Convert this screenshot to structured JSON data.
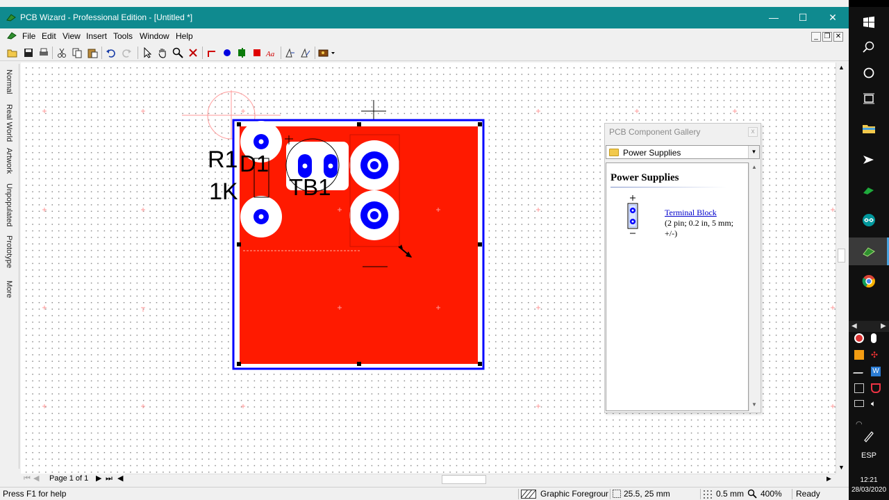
{
  "window": {
    "title": "PCB Wizard - Professional Edition - [Untitled *]",
    "minimize_glyph": "—",
    "maximize_glyph": "☐",
    "close_glyph": "✕"
  },
  "menu": [
    "File",
    "Edit",
    "View",
    "Insert",
    "Tools",
    "Window",
    "Help"
  ],
  "mdi_controls": [
    "_",
    "❐",
    "✕"
  ],
  "toolbar_icons": [
    "open-icon",
    "save-icon",
    "print-icon",
    "cut-icon",
    "copy-icon",
    "paste-icon",
    "undo-icon",
    "redo-icon",
    "select-icon",
    "pan-icon",
    "zoom-icon",
    "delete-icon",
    "track-icon",
    "pad-icon",
    "component-icon",
    "copper-area-icon",
    "rectangle-icon",
    "text-icon",
    "autoroute-icon",
    "rules-icon",
    "tools-dropdown-icon"
  ],
  "side_tabs": [
    "Normal",
    "Real World",
    "Artwork",
    "Unpopulated",
    "Prototype",
    "More"
  ],
  "board": {
    "labels": {
      "r1": "R1",
      "d1": "D1",
      "r1_value": "1K",
      "tb1": "TB1"
    },
    "copper_color": "#ff1a00",
    "outline_color": "#0000ff",
    "pad_color": "#0000ff"
  },
  "gallery": {
    "title": "PCB Component Gallery",
    "close_glyph": "x",
    "category": "Power Supplies",
    "heading": "Power Supplies",
    "items": [
      {
        "name": "Terminal Block",
        "description": "(2 pin; 0.2 in, 5 mm; +/-)",
        "icon": "terminal-block-icon"
      }
    ]
  },
  "page_nav": {
    "label": "Page 1 of 1"
  },
  "status": {
    "help": "Press F1 for help",
    "layer": "Graphic Foregrounc",
    "coords": "25.5, 25 mm",
    "grid": "0.5 mm",
    "zoom": "400%",
    "state": "Ready"
  },
  "taskbar": {
    "lang": "ESP",
    "time": "12:21",
    "date": "28/03/2020"
  }
}
